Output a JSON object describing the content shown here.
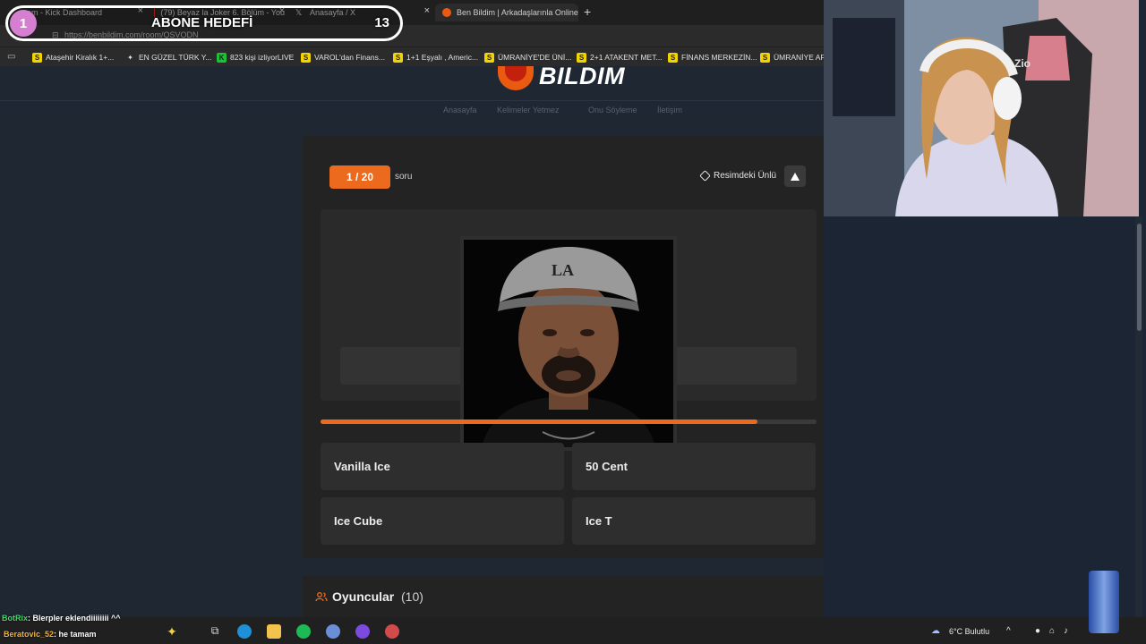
{
  "browser": {
    "tabs": [
      {
        "title": "am - Kick Dashboard"
      },
      {
        "title": "(79) Beyaz la Joker 6. Bölüm - You"
      },
      {
        "title": "Anasayfa / X"
      },
      {
        "title": "Ben Bildim | Arkadaşlarınla Online"
      }
    ],
    "url": "https://benbildim.com/room/QSVODN",
    "bookmarks": [
      "Ataşehir Kiralık 1+...",
      "EN GÜZEL TÜRK Y...",
      "823 kişi izliyorLIVE",
      "VAROL'dan Finans...",
      "1+1 Eşyalı , Americ...",
      "ÜMRANİYE'DE ÜNİ...",
      "2+1 ATAKENT MET...",
      "FİNANS MERKEZİN...",
      "ÜMRANİYE ARN"
    ]
  },
  "overlay": {
    "level": "1",
    "title": "ABONE HEDEFİ",
    "target": "13"
  },
  "site": {
    "logo": "BILDIM",
    "nav": [
      "Anasayfa",
      "Kelimeler Yetmez",
      "Onu Söyleme",
      "İletişim"
    ],
    "question": {
      "counter": "1 / 20",
      "counter_label": "soru",
      "category": "Resimdeki Ünlü",
      "progress": 0.88
    },
    "options": [
      "Vanilla Ice",
      "50 Cent",
      "Ice Cube",
      "Ice T"
    ],
    "players": {
      "title": "Oyuncular",
      "count": "(10)"
    }
  },
  "taskbar": {
    "chat_user": "BotRix",
    "chat_message": ": Blerpler eklendiiiiiiii ^^",
    "chat_user2": "Beratovic_52",
    "chat_message2": ": he tamam",
    "weather": "6°C  Bulutlu"
  },
  "colors": {
    "accent": "#ec6a1e",
    "card": "#232323",
    "page_bg": "#1f2733"
  }
}
